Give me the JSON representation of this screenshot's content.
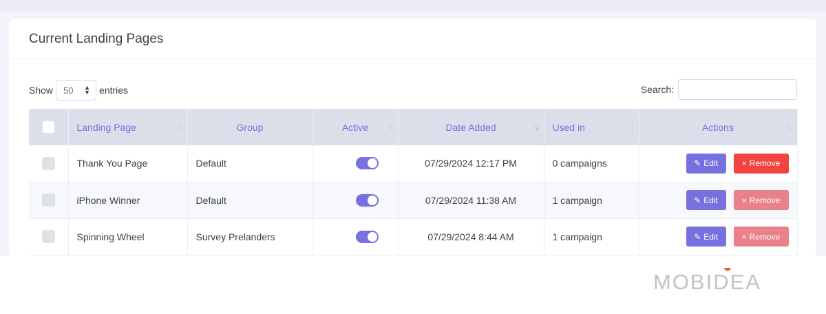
{
  "card": {
    "title": "Current Landing Pages"
  },
  "controls": {
    "show_label": "Show",
    "entries_value": "50",
    "entries_label": "entries",
    "search_label": "Search:",
    "search_value": ""
  },
  "table": {
    "columns": [
      "Landing Page",
      "Group",
      "Active",
      "Date Added",
      "Used in",
      "Actions"
    ],
    "rows": [
      {
        "landing_page": "Thank You Page",
        "group": "Default",
        "active": true,
        "date_added": "07/29/2024 12:17 PM",
        "used_in": "0 campaigns"
      },
      {
        "landing_page": "iPhone Winner",
        "group": "Default",
        "active": true,
        "date_added": "07/29/2024 11:38 AM",
        "used_in": "1 campaign"
      },
      {
        "landing_page": "Spinning Wheel",
        "group": "Survey Prelanders",
        "active": true,
        "date_added": "07/29/2024 8:44 AM",
        "used_in": "1 campaign"
      }
    ],
    "edit_label": "Edit",
    "remove_label": "Remove"
  },
  "colors": {
    "accent": "#7771e0",
    "danger": "#f4433f",
    "danger_muted": "#e9808a",
    "logo_dot": "#e8622f",
    "logo_text": "#c3c3c3"
  },
  "logo": {
    "text": "MOBIDEA"
  }
}
